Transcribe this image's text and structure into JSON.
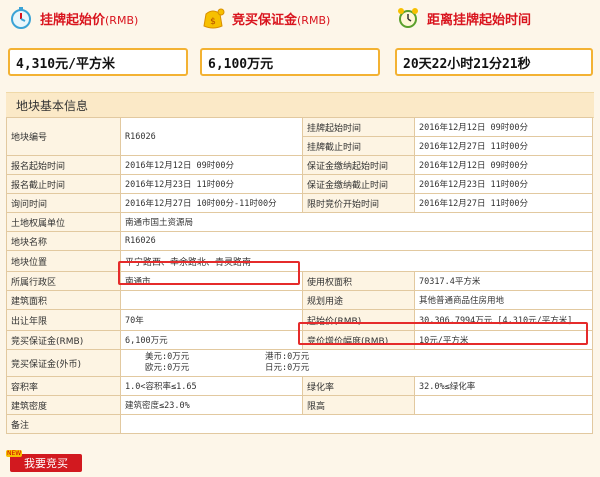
{
  "cards": [
    {
      "label": "挂牌起始价",
      "unit": "(RMB)",
      "value": "4,310元/平方米",
      "icon": "stopwatch-icon"
    },
    {
      "label": "竞买保证金",
      "unit": "(RMB)",
      "value": "6,100万元",
      "icon": "money-bag-icon"
    },
    {
      "label": "距离挂牌起始时间",
      "unit": "",
      "value": "20天22小时21分21秒",
      "icon": "alarm-clock-icon"
    }
  ],
  "section_title": "地块基本信息",
  "rows": {
    "r1": {
      "k1": "地块编号",
      "v1": "R16026",
      "k2": "挂牌起始时间",
      "v2": "2016年12月12日 09时00分"
    },
    "r2": {
      "k2": "挂牌截止时间",
      "v2": "2016年12月27日 11时00分"
    },
    "r3": {
      "k1": "报名起始时间",
      "v1": "2016年12月12日 09时00分",
      "k2": "保证金缴纳起始时间",
      "v2": "2016年12月12日 09时00分"
    },
    "r4": {
      "k1": "报名截止时间",
      "v1": "2016年12月23日 11时00分",
      "k2": "保证金缴纳截止时间",
      "v2": "2016年12月23日 11时00分"
    },
    "r5": {
      "k1": "询问时间",
      "v1": "2016年12月27日 10时00分-11时00分",
      "k2": "限时竞价开始时间",
      "v2": "2016年12月27日 11时00分"
    },
    "r6": {
      "k1": "土地权属单位",
      "v1": "南通市国土资源局"
    },
    "r7": {
      "k1": "地块名称",
      "v1": "R16026"
    },
    "r8": {
      "k1": "地块位置",
      "v1": "平宁路西、幸余路北、青灵路南"
    },
    "r9": {
      "k1": "所属行政区",
      "v1": "南通市",
      "k2": "使用权面积",
      "v2": "70317.4平方米"
    },
    "r10": {
      "k1": "建筑面积",
      "v1": "",
      "k2": "规划用途",
      "v2": "其他普通商品住房用地"
    },
    "r11": {
      "k1": "出让年限",
      "v1": "70年",
      "k2": "起始价(RMB)",
      "v2": "30,306.7994万元 [4,310元/平方米]"
    },
    "r12": {
      "k1": "竞买保证金(RMB)",
      "v1": "6,100万元",
      "k2": "竞价增价幅度(RMB)",
      "v2": "10元/平方米"
    },
    "r13": {
      "k1": "竞买保证金(外币)",
      "usd": "美元:0万元",
      "eur": "欧元:0万元",
      "hkd": "港币:0万元",
      "jpy": "日元:0万元"
    },
    "r14": {
      "k1": "容积率",
      "v1": "1.0<容积率≤1.65",
      "k2": "绿化率",
      "v2": "32.0%≤绿化率"
    },
    "r15": {
      "k1": "建筑密度",
      "v1": "建筑密度≤23.0%",
      "k2": "限高",
      "v2": ""
    },
    "r16": {
      "k1": "备注",
      "v1": ""
    }
  },
  "bid_button": {
    "label": "我要竞买",
    "tag": "NEW"
  }
}
